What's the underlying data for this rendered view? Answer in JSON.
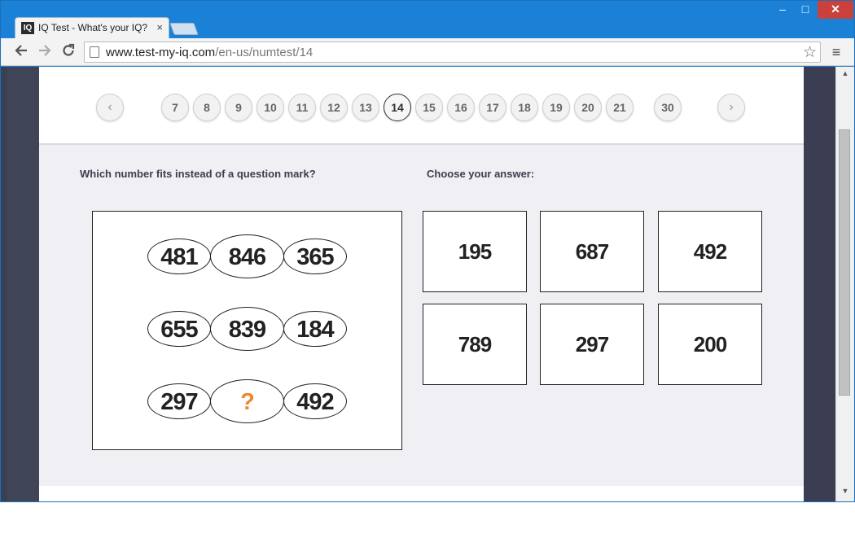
{
  "browser": {
    "tab_title": "IQ Test - What's your IQ?",
    "favicon_text": "IQ",
    "tab_close": "×",
    "url_host": "www.test-my-iq.com",
    "url_path": "/en-us/numtest/14",
    "window_controls": {
      "minimize": "–",
      "maximize": "□",
      "close": "✕"
    }
  },
  "pager": {
    "prev": "‹",
    "next": "›",
    "pages": [
      "7",
      "8",
      "9",
      "10",
      "11",
      "12",
      "13",
      "14",
      "15",
      "16",
      "17",
      "18",
      "19",
      "20",
      "21",
      "30"
    ],
    "active": "14"
  },
  "question": {
    "prompt": "Which number fits instead of a question mark?",
    "rows": [
      [
        "481",
        "846",
        "365"
      ],
      [
        "655",
        "839",
        "184"
      ],
      [
        "297",
        "?",
        "492"
      ]
    ]
  },
  "answers": {
    "prompt": "Choose your answer:",
    "options": [
      "195",
      "687",
      "492",
      "789",
      "297",
      "200"
    ]
  },
  "colors": {
    "window_frame": "#1b81d7",
    "question_mark": "#e98a33",
    "page_background": "#f0eff4"
  },
  "icons": {
    "back": "arrow-left-icon",
    "forward": "arrow-right-icon",
    "reload": "reload-icon",
    "bookmark": "star-icon",
    "menu": "hamburger-icon"
  }
}
